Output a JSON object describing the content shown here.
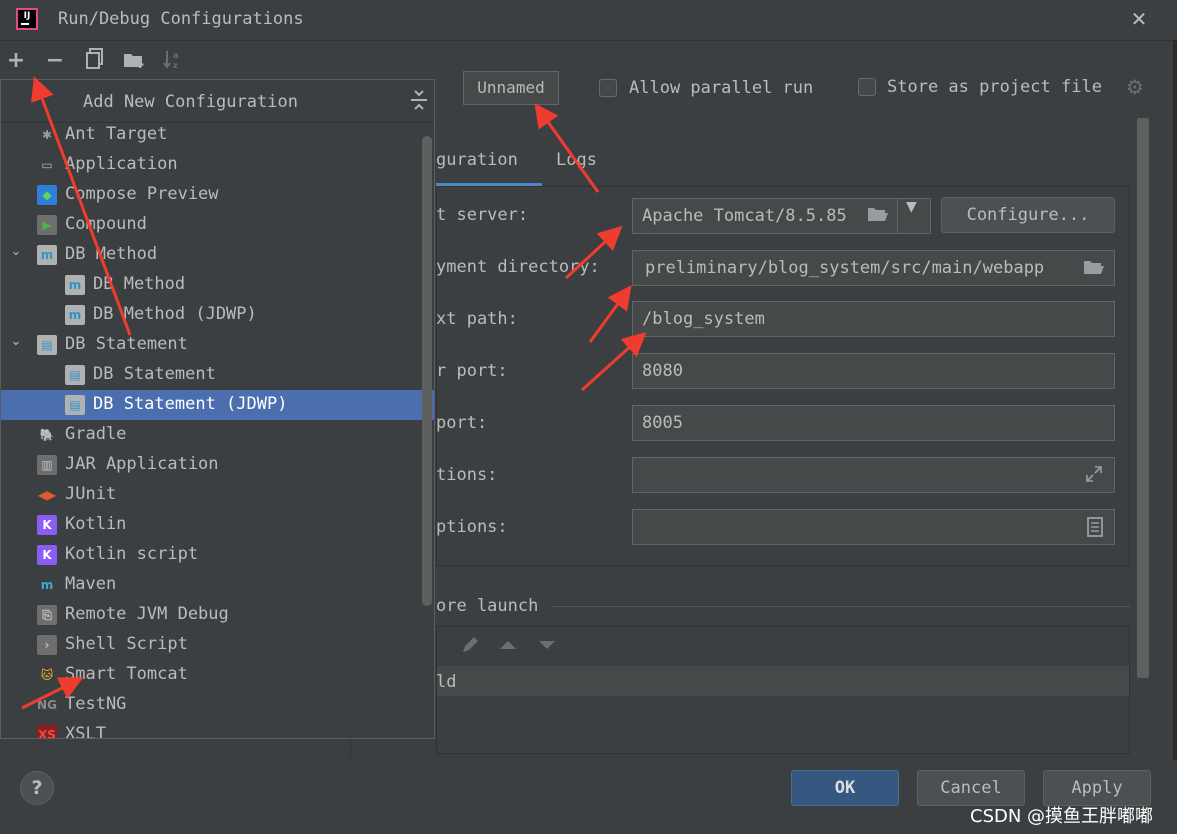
{
  "window": {
    "title": "Run/Debug Configurations",
    "logo_text": "IJ"
  },
  "toolbar": {
    "add": "+",
    "remove": "−"
  },
  "popup": {
    "title": "Add New Configuration",
    "items": [
      {
        "label": "Ant Target",
        "icon": "ant-icon"
      },
      {
        "label": "Application",
        "icon": "application-icon"
      },
      {
        "label": "Compose Preview",
        "icon": "compose-icon"
      },
      {
        "label": "Compound",
        "icon": "compound-icon"
      },
      {
        "label": "DB Method",
        "icon": "db-method-icon",
        "expanded": true
      },
      {
        "label": "DB Method",
        "icon": "db-method-icon",
        "child": true
      },
      {
        "label": "DB Method (JDWP)",
        "icon": "db-method-icon",
        "child": true
      },
      {
        "label": "DB Statement",
        "icon": "db-statement-icon",
        "expanded": true
      },
      {
        "label": "DB Statement",
        "icon": "db-statement-icon",
        "child": true
      },
      {
        "label": "DB Statement (JDWP)",
        "icon": "db-statement-icon",
        "child": true,
        "selected": true
      },
      {
        "label": "Gradle",
        "icon": "gradle-icon"
      },
      {
        "label": "JAR Application",
        "icon": "jar-icon"
      },
      {
        "label": "JUnit",
        "icon": "junit-icon"
      },
      {
        "label": "Kotlin",
        "icon": "kotlin-icon"
      },
      {
        "label": "Kotlin script",
        "icon": "kotlin-icon"
      },
      {
        "label": "Maven",
        "icon": "maven-icon"
      },
      {
        "label": "Remote JVM Debug",
        "icon": "remote-debug-icon"
      },
      {
        "label": "Shell Script",
        "icon": "shell-icon"
      },
      {
        "label": "Smart Tomcat",
        "icon": "tomcat-icon"
      },
      {
        "label": "TestNG",
        "icon": "testng-icon"
      },
      {
        "label": "XSLT",
        "icon": "xslt-icon"
      }
    ]
  },
  "config": {
    "name": "Unnamed",
    "allow_parallel_run": "Allow parallel run",
    "store_as_project_file": "Store as project file",
    "tabs": {
      "configuration": "guration",
      "logs": "Logs"
    },
    "fields": {
      "server_label": "t server:",
      "server_value": "Apache Tomcat/8.5.85",
      "configure_button": "Configure...",
      "deployment_label": "yment directory:",
      "deployment_value": "preliminary/blog_system/src/main/webapp",
      "context_label": "xt path:",
      "context_value": "/blog_system",
      "server_port_label": "r port:",
      "server_port_value": "8080",
      "admin_port_label": " port:",
      "admin_port_value": "8005",
      "vm_options_label": "tions:",
      "env_options_label": "ptions:"
    },
    "before_launch": {
      "label": "ore launch",
      "row_text": "ld"
    }
  },
  "footer": {
    "help": "?",
    "ok": "OK",
    "cancel": "Cancel",
    "apply": "Apply",
    "watermark": "CSDN @摸鱼王胖嘟嘟"
  },
  "colors": {
    "background": "#3c3f41",
    "selection": "#4b6eaf",
    "tab_underline": "#4a88c7",
    "ok_button": "#365880",
    "annotation_arrow": "#f03c2e"
  }
}
